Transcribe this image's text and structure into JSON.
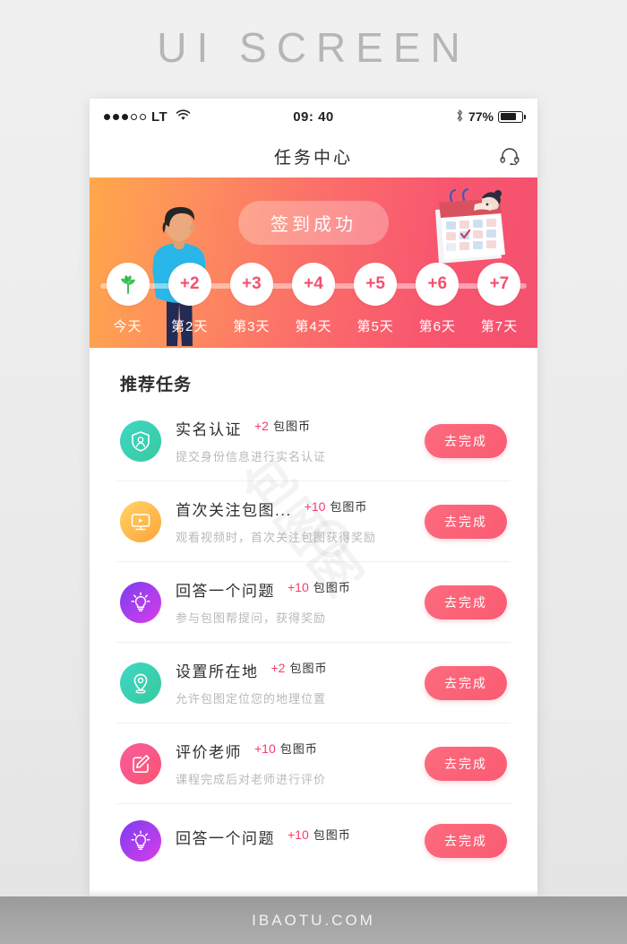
{
  "watermark": {
    "header": "UI SCREEN",
    "footer": "IBAOTU.COM",
    "content": "包图网"
  },
  "status_bar": {
    "carrier": "LT",
    "time": "09: 40",
    "battery_percent": "77%",
    "signal_dots_filled": 3,
    "signal_dots_total": 5,
    "wifi_icon": "wifi-icon",
    "bluetooth_icon": "bluetooth-icon",
    "battery_icon": "battery-icon"
  },
  "navbar": {
    "title": "任务中心",
    "service_icon": "headset-icon"
  },
  "banner": {
    "signin_label": "签到成功",
    "colors": {
      "gradient_start": "#ffa84a",
      "gradient_end": "#f4506f"
    },
    "character_illustration": "standing-man-illustration",
    "calendar_illustration": "calendar-person-illustration",
    "days": [
      {
        "bubble": "",
        "icon": "sprout-icon",
        "label": "今天",
        "checked": true
      },
      {
        "bubble": "+2",
        "icon": "",
        "label": "第2天",
        "checked": false
      },
      {
        "bubble": "+3",
        "icon": "",
        "label": "第3天",
        "checked": false
      },
      {
        "bubble": "+4",
        "icon": "",
        "label": "第4天",
        "checked": false
      },
      {
        "bubble": "+5",
        "icon": "",
        "label": "第5天",
        "checked": false
      },
      {
        "bubble": "+6",
        "icon": "",
        "label": "第6天",
        "checked": false
      },
      {
        "bubble": "+7",
        "icon": "",
        "label": "第7天",
        "checked": false
      }
    ]
  },
  "tasks_section": {
    "title": "推荐任务",
    "action_label": "去完成",
    "reward_unit": "包图币",
    "items": [
      {
        "name": "实名认证",
        "reward": "+2",
        "unit": "包图币",
        "desc": "提交身份信息进行实名认证",
        "icon": "shield-user-icon",
        "icon_gradient_start": "#3fd7c5",
        "icon_gradient_end": "#38c9a0",
        "action": "去完成"
      },
      {
        "name": "首次关注包图...",
        "reward": "+10",
        "unit": "包图币",
        "desc": "观看视频时，首次关注包图获得奖励",
        "icon": "video-monitor-icon",
        "icon_gradient_start": "#ffa33c",
        "icon_gradient_end": "#ffd464",
        "action": "去完成"
      },
      {
        "name": "回答一个问题",
        "reward": "+10",
        "unit": "包图币",
        "desc": "参与包图帮提问，获得奖励",
        "icon": "lightbulb-icon",
        "icon_gradient_start": "#7b3ff2",
        "icon_gradient_end": "#d83ce8",
        "action": "去完成"
      },
      {
        "name": "设置所在地",
        "reward": "+2",
        "unit": "包图币",
        "desc": "允许包图定位您的地理位置",
        "icon": "location-pin-icon",
        "icon_gradient_start": "#3fd7c5",
        "icon_gradient_end": "#38c9a0",
        "action": "去完成"
      },
      {
        "name": "评价老师",
        "reward": "+10",
        "unit": "包图币",
        "desc": "课程完成后对老师进行评价",
        "icon": "edit-square-icon",
        "icon_gradient_start": "#fa5b9e",
        "icon_gradient_end": "#f9556f",
        "action": "去完成"
      },
      {
        "name": "回答一个问题",
        "reward": "+10",
        "unit": "包图币",
        "desc": "",
        "icon": "lightbulb-icon",
        "icon_gradient_start": "#7b3ff2",
        "icon_gradient_end": "#d83ce8",
        "action": "去完成"
      }
    ]
  }
}
